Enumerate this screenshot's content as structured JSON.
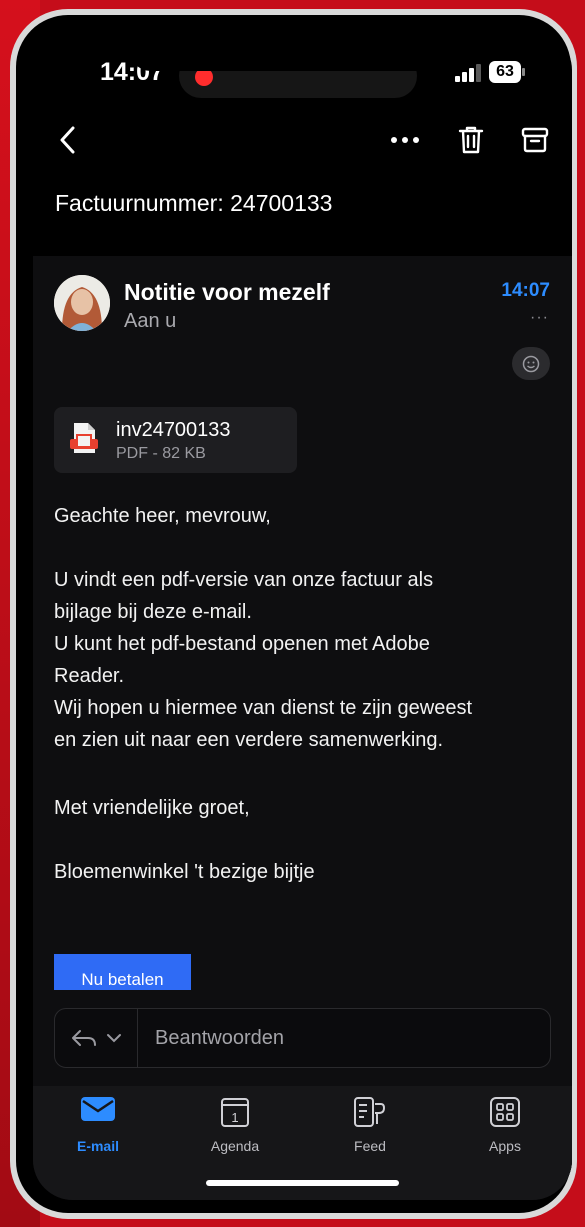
{
  "status": {
    "time": "14:07",
    "battery": "63"
  },
  "toolbar": {
    "back_icon": "chevron-left-icon",
    "more_icon": "more-horizontal-icon",
    "delete_icon": "trash-icon",
    "archive_icon": "archive-icon"
  },
  "email": {
    "subject": "Factuurnummer: 24700133",
    "sender": "Notitie voor mezelf",
    "recipient": "Aan u",
    "time": "14:07",
    "more": "···",
    "attachment": {
      "name": "inv24700133",
      "meta": "PDF - 82 KB"
    },
    "greeting": "Geachte heer, mevrouw,",
    "paragraph_lines": [
      "U vindt een pdf-versie van onze factuur als",
      "bijlage bij deze e-mail.",
      "U kunt het pdf-bestand openen met Adobe",
      "Reader.",
      "Wij hopen u hiermee van dienst te zijn geweest",
      "en zien uit naar een verdere samenwerking."
    ],
    "closing": "Met vriendelijke groet,",
    "signature": "Bloemenwinkel 't bezige bijtje",
    "pay_button": "Nu betalen"
  },
  "reply": {
    "placeholder": "Beantwoorden"
  },
  "tabs": [
    {
      "label": "E-mail",
      "icon": "mail-icon",
      "active": true
    },
    {
      "label": "Agenda",
      "icon": "calendar-icon",
      "active": false
    },
    {
      "label": "Feed",
      "icon": "feed-icon",
      "active": false
    },
    {
      "label": "Apps",
      "icon": "apps-icon",
      "active": false
    }
  ],
  "colors": {
    "accent": "#2d8cff",
    "pay_button": "#2f6bf5",
    "frame_red": "#c50d1a"
  }
}
